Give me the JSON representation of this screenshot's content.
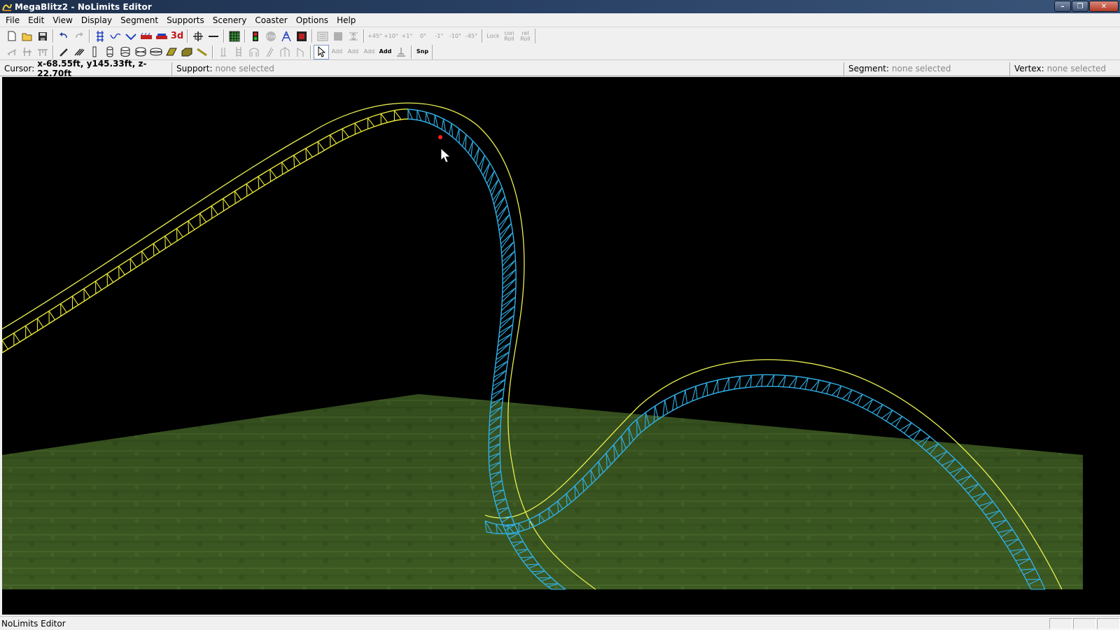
{
  "window": {
    "title": "MegaBlitz2 - NoLimits Editor",
    "minimize": "–",
    "maximize": "❐",
    "close": "✕"
  },
  "menu": [
    "File",
    "Edit",
    "View",
    "Display",
    "Segment",
    "Supports",
    "Scenery",
    "Coaster",
    "Options",
    "Help"
  ],
  "toolbar1": {
    "three_d_label": "3d",
    "roll_buttons": [
      "+45°",
      "+10°",
      "+1°",
      "0°",
      "-1°",
      "-10°",
      "-45°"
    ],
    "lock_label": "Lock",
    "con_roll_label": "con Roll",
    "rel_roll_label": "rel Roll"
  },
  "toolbar2": {
    "add_buttons": [
      "Add",
      "Add",
      "Add",
      "Add"
    ],
    "snap_label": "Snp"
  },
  "infobar": {
    "cursor_label": "Cursor:",
    "cursor_value": "x-68.55ft, y145.33ft, z-22.70ft",
    "support_label": "Support:",
    "support_value": "none selected",
    "segment_label": "Segment:",
    "segment_value": "none selected",
    "vertex_label": "Vertex:",
    "vertex_value": "none selected"
  },
  "viewport": {
    "background": "#000000",
    "ground_color": "#3e5a22",
    "selected_track_color": "#e8e83a",
    "track_color": "#2fb0e8",
    "heartline_color": "#e8f050",
    "vertex_marker_color": "#ff2020"
  },
  "status": {
    "text": "NoLimits Editor"
  }
}
